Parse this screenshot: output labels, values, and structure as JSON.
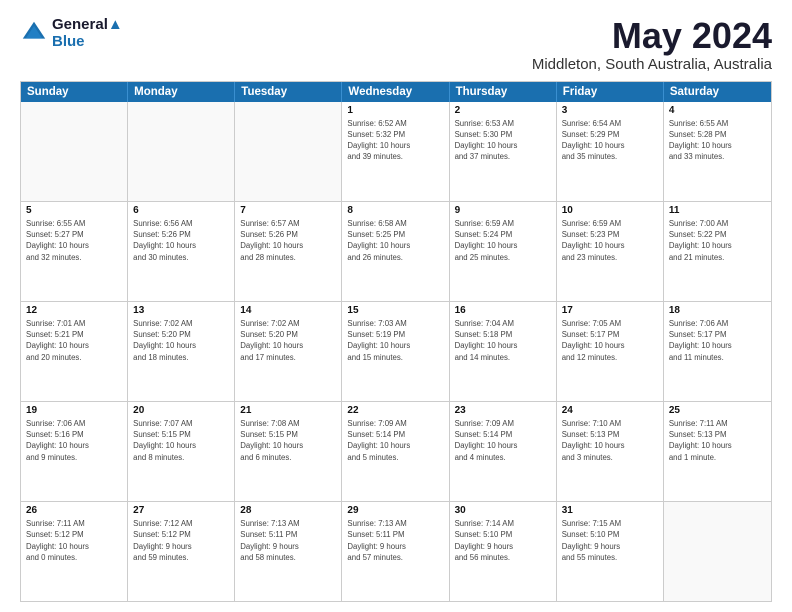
{
  "logo": {
    "line1": "General",
    "line2": "Blue"
  },
  "title": "May 2024",
  "subtitle": "Middleton, South Australia, Australia",
  "days": [
    "Sunday",
    "Monday",
    "Tuesday",
    "Wednesday",
    "Thursday",
    "Friday",
    "Saturday"
  ],
  "weeks": [
    [
      {
        "num": "",
        "info": ""
      },
      {
        "num": "",
        "info": ""
      },
      {
        "num": "",
        "info": ""
      },
      {
        "num": "1",
        "info": "Sunrise: 6:52 AM\nSunset: 5:32 PM\nDaylight: 10 hours\nand 39 minutes."
      },
      {
        "num": "2",
        "info": "Sunrise: 6:53 AM\nSunset: 5:30 PM\nDaylight: 10 hours\nand 37 minutes."
      },
      {
        "num": "3",
        "info": "Sunrise: 6:54 AM\nSunset: 5:29 PM\nDaylight: 10 hours\nand 35 minutes."
      },
      {
        "num": "4",
        "info": "Sunrise: 6:55 AM\nSunset: 5:28 PM\nDaylight: 10 hours\nand 33 minutes."
      }
    ],
    [
      {
        "num": "5",
        "info": "Sunrise: 6:55 AM\nSunset: 5:27 PM\nDaylight: 10 hours\nand 32 minutes."
      },
      {
        "num": "6",
        "info": "Sunrise: 6:56 AM\nSunset: 5:26 PM\nDaylight: 10 hours\nand 30 minutes."
      },
      {
        "num": "7",
        "info": "Sunrise: 6:57 AM\nSunset: 5:26 PM\nDaylight: 10 hours\nand 28 minutes."
      },
      {
        "num": "8",
        "info": "Sunrise: 6:58 AM\nSunset: 5:25 PM\nDaylight: 10 hours\nand 26 minutes."
      },
      {
        "num": "9",
        "info": "Sunrise: 6:59 AM\nSunset: 5:24 PM\nDaylight: 10 hours\nand 25 minutes."
      },
      {
        "num": "10",
        "info": "Sunrise: 6:59 AM\nSunset: 5:23 PM\nDaylight: 10 hours\nand 23 minutes."
      },
      {
        "num": "11",
        "info": "Sunrise: 7:00 AM\nSunset: 5:22 PM\nDaylight: 10 hours\nand 21 minutes."
      }
    ],
    [
      {
        "num": "12",
        "info": "Sunrise: 7:01 AM\nSunset: 5:21 PM\nDaylight: 10 hours\nand 20 minutes."
      },
      {
        "num": "13",
        "info": "Sunrise: 7:02 AM\nSunset: 5:20 PM\nDaylight: 10 hours\nand 18 minutes."
      },
      {
        "num": "14",
        "info": "Sunrise: 7:02 AM\nSunset: 5:20 PM\nDaylight: 10 hours\nand 17 minutes."
      },
      {
        "num": "15",
        "info": "Sunrise: 7:03 AM\nSunset: 5:19 PM\nDaylight: 10 hours\nand 15 minutes."
      },
      {
        "num": "16",
        "info": "Sunrise: 7:04 AM\nSunset: 5:18 PM\nDaylight: 10 hours\nand 14 minutes."
      },
      {
        "num": "17",
        "info": "Sunrise: 7:05 AM\nSunset: 5:17 PM\nDaylight: 10 hours\nand 12 minutes."
      },
      {
        "num": "18",
        "info": "Sunrise: 7:06 AM\nSunset: 5:17 PM\nDaylight: 10 hours\nand 11 minutes."
      }
    ],
    [
      {
        "num": "19",
        "info": "Sunrise: 7:06 AM\nSunset: 5:16 PM\nDaylight: 10 hours\nand 9 minutes."
      },
      {
        "num": "20",
        "info": "Sunrise: 7:07 AM\nSunset: 5:15 PM\nDaylight: 10 hours\nand 8 minutes."
      },
      {
        "num": "21",
        "info": "Sunrise: 7:08 AM\nSunset: 5:15 PM\nDaylight: 10 hours\nand 6 minutes."
      },
      {
        "num": "22",
        "info": "Sunrise: 7:09 AM\nSunset: 5:14 PM\nDaylight: 10 hours\nand 5 minutes."
      },
      {
        "num": "23",
        "info": "Sunrise: 7:09 AM\nSunset: 5:14 PM\nDaylight: 10 hours\nand 4 minutes."
      },
      {
        "num": "24",
        "info": "Sunrise: 7:10 AM\nSunset: 5:13 PM\nDaylight: 10 hours\nand 3 minutes."
      },
      {
        "num": "25",
        "info": "Sunrise: 7:11 AM\nSunset: 5:13 PM\nDaylight: 10 hours\nand 1 minute."
      }
    ],
    [
      {
        "num": "26",
        "info": "Sunrise: 7:11 AM\nSunset: 5:12 PM\nDaylight: 10 hours\nand 0 minutes."
      },
      {
        "num": "27",
        "info": "Sunrise: 7:12 AM\nSunset: 5:12 PM\nDaylight: 9 hours\nand 59 minutes."
      },
      {
        "num": "28",
        "info": "Sunrise: 7:13 AM\nSunset: 5:11 PM\nDaylight: 9 hours\nand 58 minutes."
      },
      {
        "num": "29",
        "info": "Sunrise: 7:13 AM\nSunset: 5:11 PM\nDaylight: 9 hours\nand 57 minutes."
      },
      {
        "num": "30",
        "info": "Sunrise: 7:14 AM\nSunset: 5:10 PM\nDaylight: 9 hours\nand 56 minutes."
      },
      {
        "num": "31",
        "info": "Sunrise: 7:15 AM\nSunset: 5:10 PM\nDaylight: 9 hours\nand 55 minutes."
      },
      {
        "num": "",
        "info": ""
      }
    ]
  ]
}
